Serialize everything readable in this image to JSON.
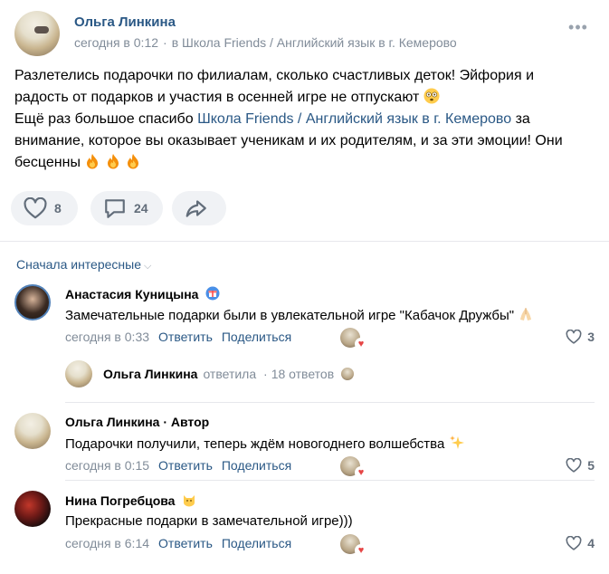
{
  "post": {
    "author": "Ольга Линкина",
    "time": "сегодня в 0:12",
    "dot": "·",
    "group": "в Школа Friends / Английский язык в г. Кемерово",
    "more_icon": "•••",
    "text_line1": "Разлетелись подарочки по филиалам, сколько счастливых деток! Эйфория и",
    "text_line2": "радость от подарков и участия в осенней игре не отпускают",
    "text_line3_pre": "Ещё раз большое спасибо",
    "text_line3_link": "Школа Friends / Английский язык в г. Кемерово",
    "text_line3_post": "за",
    "text_line4": "внимание, которое вы оказывает ученикам и их родителям, и за эти эмоции! Они",
    "text_line5": "бесценны",
    "likes": "8",
    "comments": "24"
  },
  "comments_section": {
    "sort_label": "Сначала интересные",
    "sort_chevron": "⌵",
    "items": [
      {
        "author": "Анастасия Куницына",
        "text": "Замечательные подарки были в увлекательной игре \"Кабачок Дружбы\"",
        "time": "сегодня в 0:33",
        "reply": "Ответить",
        "share": "Поделиться",
        "likes": "3"
      },
      {
        "author": "Ольга Линкина · Автор",
        "text": "Подарочки получили, теперь ждём новогоднего волшебства",
        "time": "сегодня в 0:15",
        "reply": "Ответить",
        "share": "Поделиться",
        "likes": "5"
      },
      {
        "author": "Нина Погребцова",
        "text": "Прекрасные подарки в замечательной игре)))",
        "time": "сегодня в 6:14",
        "reply": "Ответить",
        "share": "Поделиться",
        "likes": "4"
      }
    ],
    "thread": {
      "author": "Ольга Линкина",
      "action": "ответила",
      "dot": "·",
      "count": "18 ответов"
    }
  },
  "icons": {
    "like": "heart-icon",
    "comment": "comment-icon",
    "share": "share-icon",
    "more": "more-icon"
  },
  "colors": {
    "link": "#2a5885",
    "meta": "#818c99",
    "button_bg": "#f0f2f5",
    "heart_red": "#e64646"
  }
}
